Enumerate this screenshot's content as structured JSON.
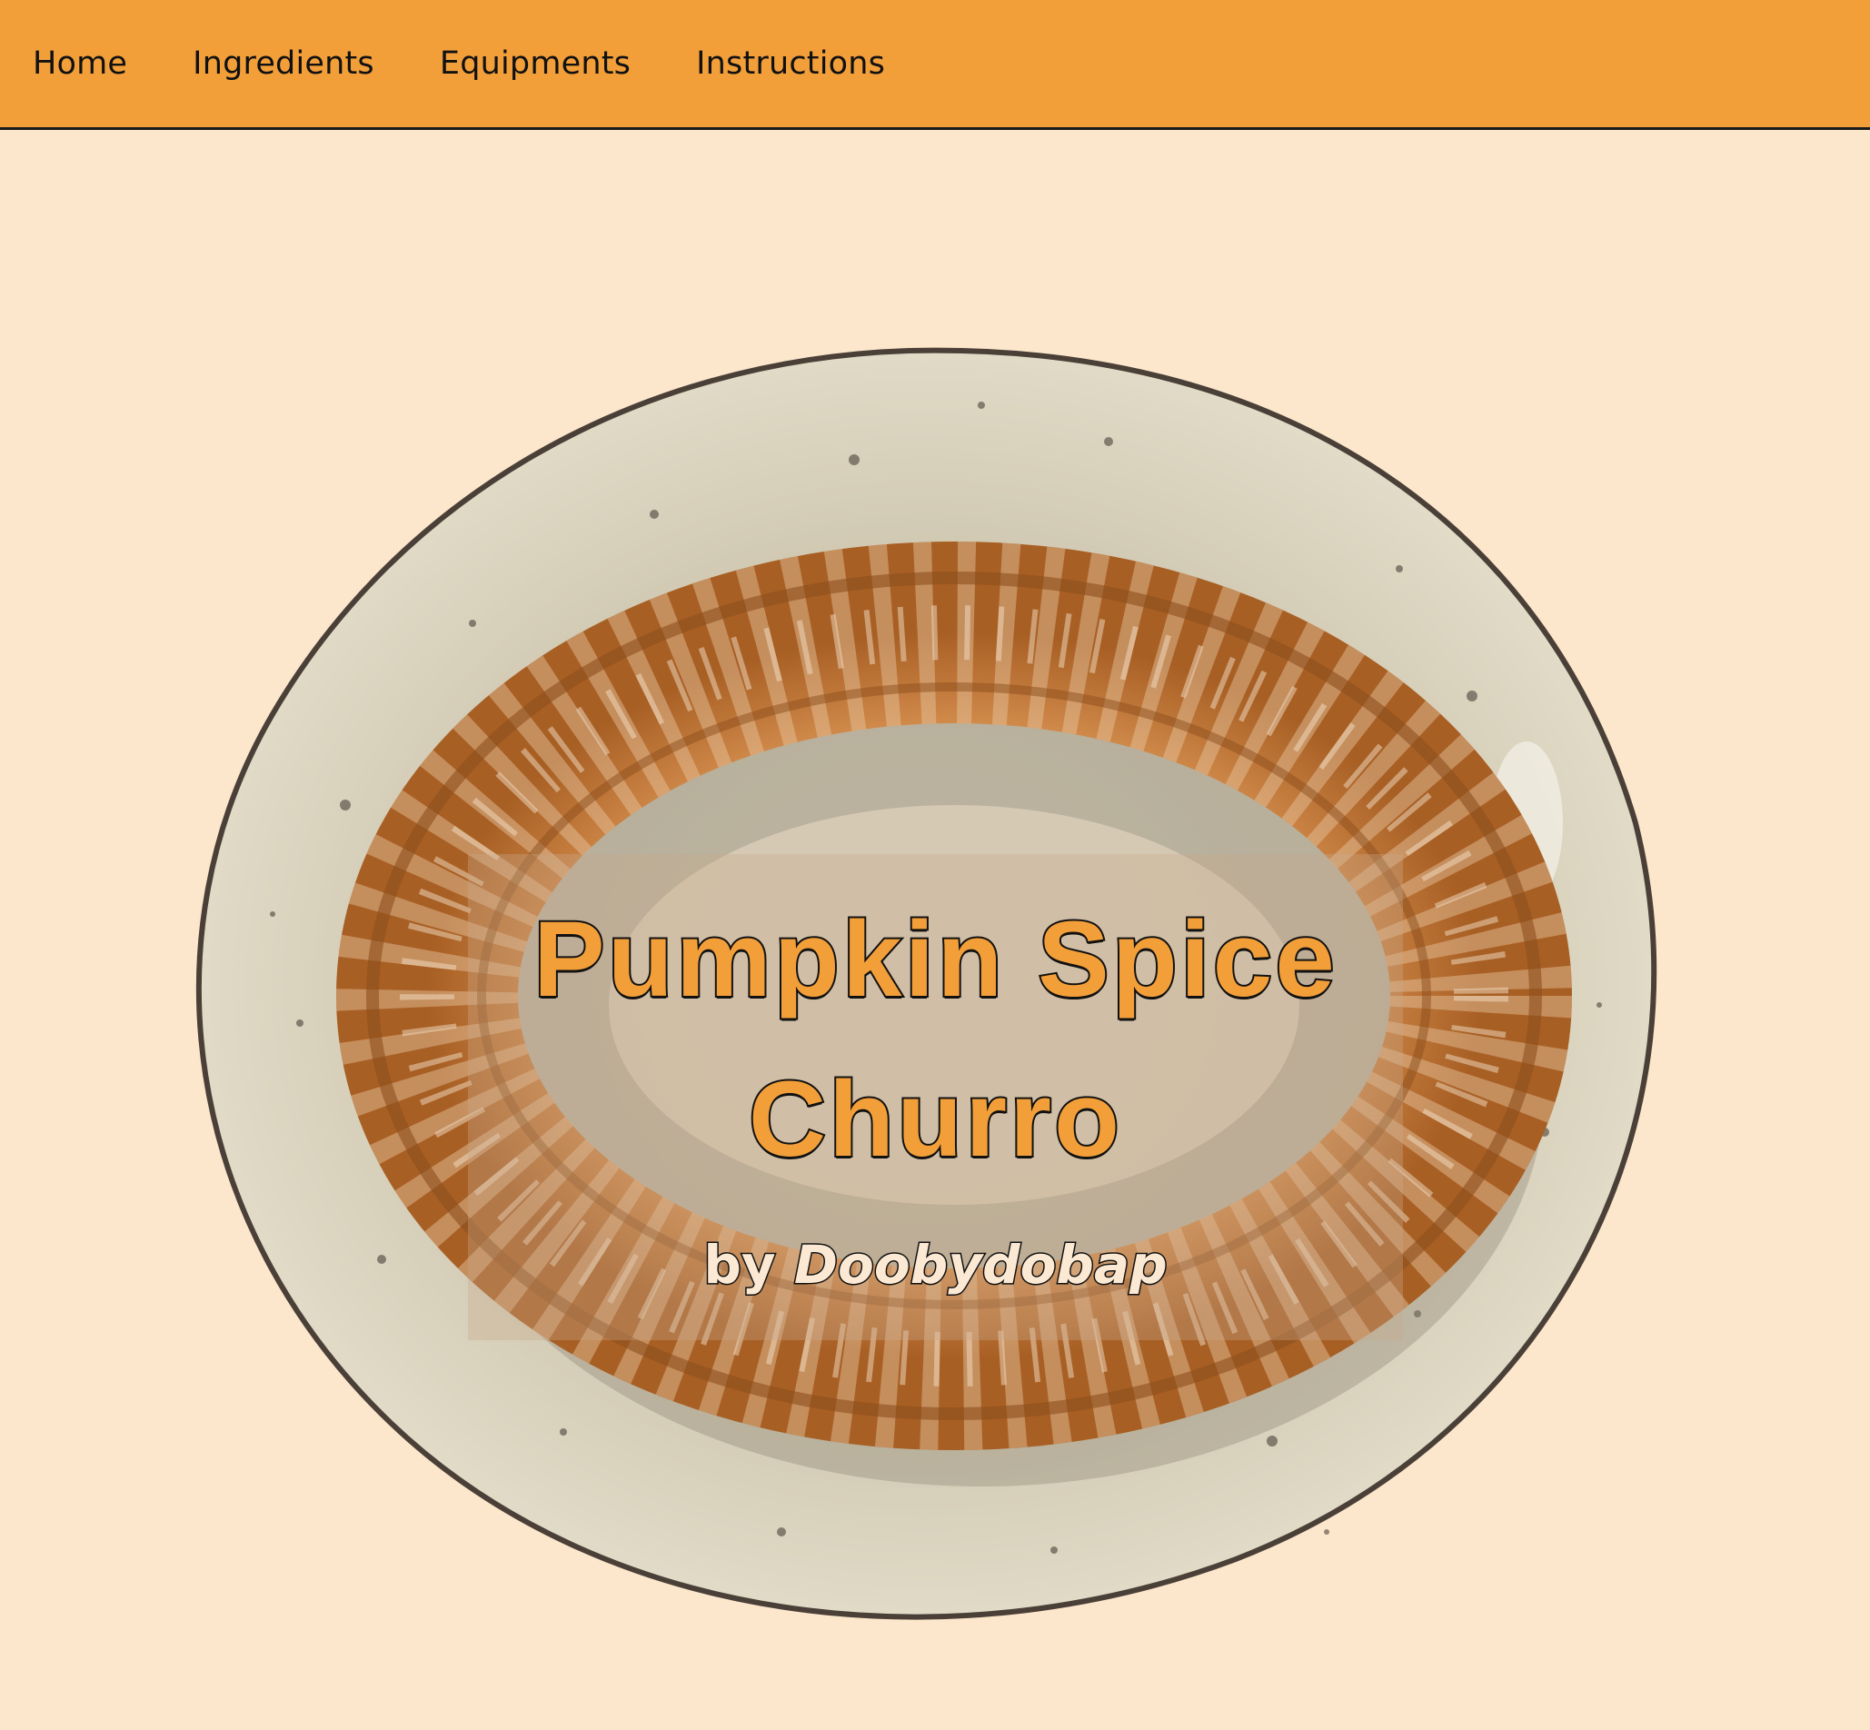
{
  "nav": {
    "items": [
      {
        "label": "Home"
      },
      {
        "label": "Ingredients"
      },
      {
        "label": "Equipments"
      },
      {
        "label": "Instructions"
      }
    ]
  },
  "hero": {
    "title_line1": "Pumpkin Spice",
    "title_line2": "Churro",
    "byline_prefix": "by",
    "byline_author": "Doobydobap"
  },
  "colors": {
    "nav_bg": "#f29f3a",
    "page_bg": "#fce7cc",
    "title_fill": "#f29f3a",
    "byline_fill": "#fbe9d4",
    "outline": "#111111"
  }
}
